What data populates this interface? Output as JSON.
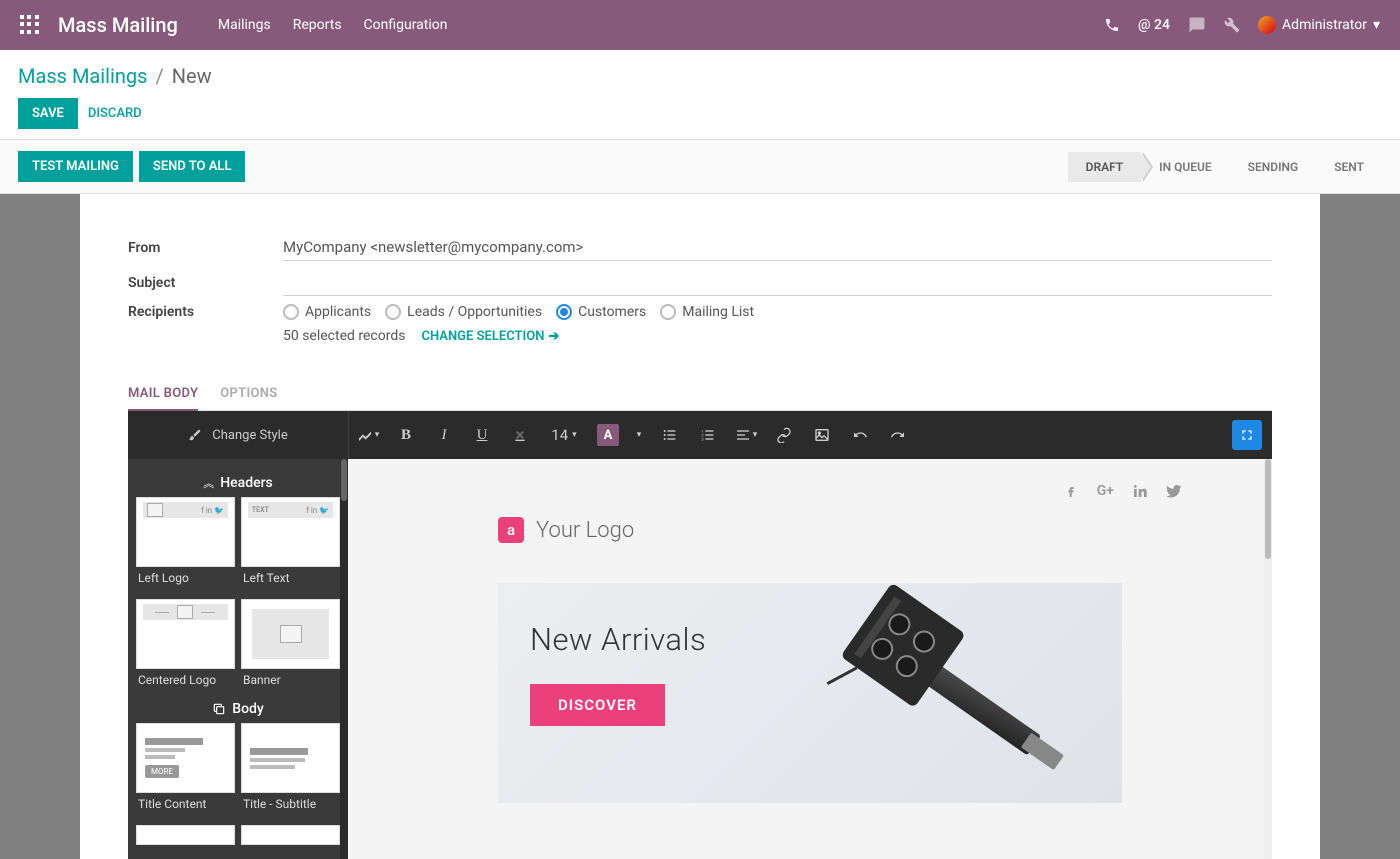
{
  "topbar": {
    "app_title": "Mass Mailing",
    "nav": [
      "Mailings",
      "Reports",
      "Configuration"
    ],
    "msg_count": "@ 24",
    "user": "Administrator"
  },
  "breadcrumb": {
    "parent": "Mass Mailings",
    "sep": "/",
    "current": "New"
  },
  "buttons": {
    "save": "SAVE",
    "discard": "DISCARD",
    "test": "TEST MAILING",
    "sendall": "SEND TO ALL"
  },
  "status": [
    "DRAFT",
    "IN QUEUE",
    "SENDING",
    "SENT"
  ],
  "form": {
    "from_label": "From",
    "from_value": "MyCompany <newsletter@mycompany.com>",
    "subject_label": "Subject",
    "subject_value": "",
    "recipients_label": "Recipients",
    "recipients_opts": [
      "Applicants",
      "Leads / Opportunities",
      "Customers",
      "Mailing List"
    ],
    "selected_records": "50 selected records",
    "change_selection": "CHANGE SELECTION"
  },
  "tabs": {
    "body": "MAIL BODY",
    "options": "OPTIONS"
  },
  "toolbar": {
    "change_style": "Change Style",
    "font_size": "14"
  },
  "sidebar": {
    "headers_title": "Headers",
    "body_title": "Body",
    "thumbs": {
      "left_logo": "Left Logo",
      "left_text": "Left Text",
      "left_text_badge": "TEXT",
      "centered_logo": "Centered Logo",
      "banner": "Banner",
      "title_content": "Title Content",
      "more": "MORE",
      "title_subtitle": "Title - Subtitle"
    }
  },
  "canvas": {
    "logo_badge": "a",
    "logo_text": "Your Logo",
    "hero_title": "New Arrivals",
    "hero_btn": "DISCOVER"
  }
}
